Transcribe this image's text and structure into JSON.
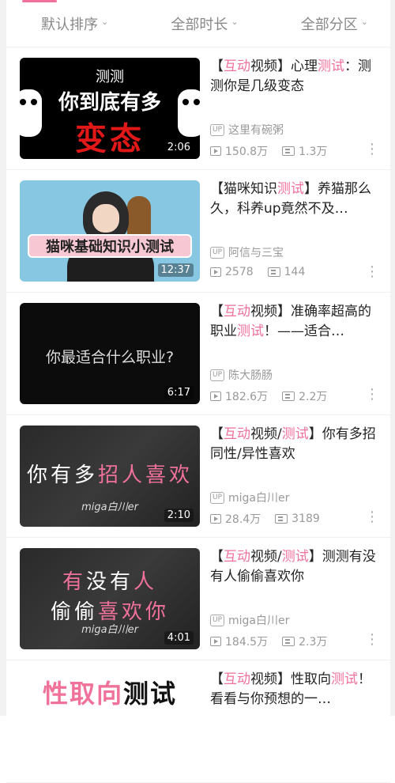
{
  "filters": [
    {
      "label": "默认排序"
    },
    {
      "label": "全部时长"
    },
    {
      "label": "全部分区"
    }
  ],
  "videos": [
    {
      "title_parts": [
        {
          "t": "【",
          "h": false
        },
        {
          "t": "互动",
          "h": true
        },
        {
          "t": "视频】心理",
          "h": false
        },
        {
          "t": "测试",
          "h": true
        },
        {
          "t": "：测测你是几级变态",
          "h": false
        }
      ],
      "uploader": "这里有碗粥",
      "views": "150.8万",
      "danmaku": "1.3万",
      "duration": "2:06",
      "thumb": {
        "line1": "测测",
        "line2": "你到底有多",
        "line3": "变态"
      }
    },
    {
      "title_parts": [
        {
          "t": "【猫咪知识",
          "h": false
        },
        {
          "t": "测试",
          "h": true
        },
        {
          "t": "】养猫那么久，科养up竟然不及…",
          "h": false
        }
      ],
      "uploader": "阿信与三宝",
      "views": "2578",
      "danmaku": "144",
      "duration": "12:37",
      "thumb": {
        "banner": "猫咪基础知识小测试"
      }
    },
    {
      "title_parts": [
        {
          "t": "【",
          "h": false
        },
        {
          "t": "互动",
          "h": true
        },
        {
          "t": "视频】准确率超高的职业",
          "h": false
        },
        {
          "t": "测试",
          "h": true
        },
        {
          "t": "！——适合…",
          "h": false
        }
      ],
      "uploader": "陈大肠肠",
      "views": "182.6万",
      "danmaku": "2.2万",
      "duration": "6:17",
      "thumb": {
        "line1": "你最适合什么职业?"
      }
    },
    {
      "title_parts": [
        {
          "t": "【",
          "h": false
        },
        {
          "t": "互动",
          "h": true
        },
        {
          "t": "视频/",
          "h": false
        },
        {
          "t": "测试",
          "h": true
        },
        {
          "t": "】你有多招同性/异性喜欢",
          "h": false
        }
      ],
      "uploader": "miga白川er",
      "views": "28.4万",
      "danmaku": "3189",
      "duration": "2:10",
      "thumb": {
        "white": "你有多",
        "pink": "招人喜欢",
        "sign": "miga白川er"
      }
    },
    {
      "title_parts": [
        {
          "t": "【",
          "h": false
        },
        {
          "t": "互动",
          "h": true
        },
        {
          "t": "视频/",
          "h": false
        },
        {
          "t": "测试",
          "h": true
        },
        {
          "t": "】测测有没有人偷偷喜欢你",
          "h": false
        }
      ],
      "uploader": "miga白川er",
      "views": "184.5万",
      "danmaku": "2.3万",
      "duration": "4:01",
      "thumb": {
        "l1_pink": "有",
        "l1_white": "没有",
        "l1_pink2": "人",
        "l2_white": "偷偷",
        "l2_pink": "喜欢你",
        "sign": "miga白川er"
      }
    },
    {
      "title_parts": [
        {
          "t": "【",
          "h": false
        },
        {
          "t": "互动",
          "h": true
        },
        {
          "t": "视频】性取向",
          "h": false
        },
        {
          "t": "测",
          "h": true
        },
        {
          "t": "试",
          "h": true
        },
        {
          "t": "！看看与你预想的一…",
          "h": false
        }
      ],
      "uploader": "",
      "views": "",
      "danmaku": "",
      "duration": "",
      "thumb": {
        "pink": "性取向",
        "dark": "测试"
      }
    }
  ],
  "colors": {
    "accent": "#f0719a"
  }
}
